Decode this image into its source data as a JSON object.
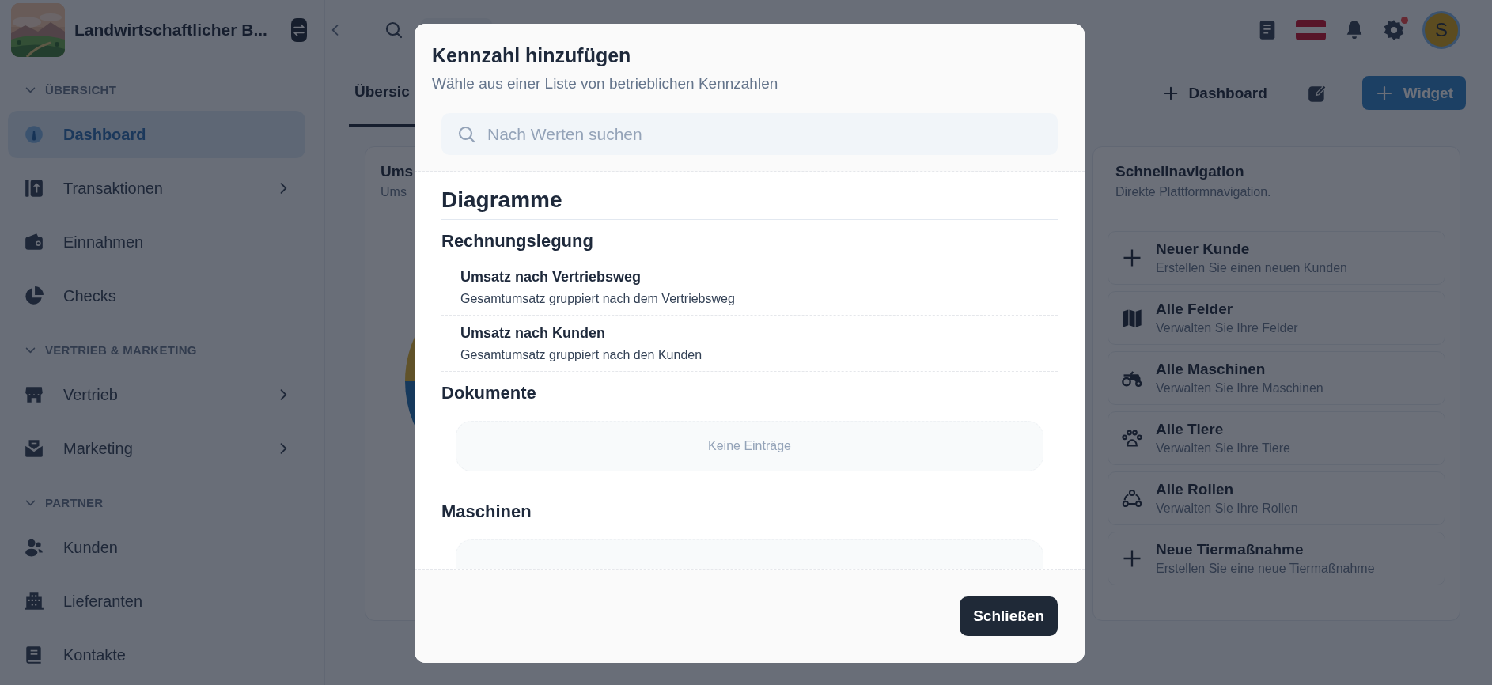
{
  "sidebar": {
    "company": "Landwirtschaftlicher B...",
    "sections": [
      {
        "title": "ÜBERSICHT",
        "expanded": true,
        "items": [
          {
            "label": "Dashboard",
            "selected": true,
            "has_submenu": false
          },
          {
            "label": "Transaktionen",
            "selected": false,
            "has_submenu": true
          },
          {
            "label": "Einnahmen",
            "selected": false,
            "has_submenu": false
          },
          {
            "label": "Checks",
            "selected": false,
            "has_submenu": false
          }
        ]
      },
      {
        "title": "VERTRIEB & MARKETING",
        "expanded": true,
        "items": [
          {
            "label": "Vertrieb",
            "selected": false,
            "has_submenu": true
          },
          {
            "label": "Marketing",
            "selected": false,
            "has_submenu": true
          }
        ]
      },
      {
        "title": "PARTNER",
        "expanded": true,
        "items": [
          {
            "label": "Kunden",
            "selected": false,
            "has_submenu": false
          },
          {
            "label": "Lieferanten",
            "selected": false,
            "has_submenu": false
          },
          {
            "label": "Kontakte",
            "selected": false,
            "has_submenu": false
          }
        ]
      }
    ]
  },
  "topbar": {
    "settings_badge": true,
    "avatar_initial": "S"
  },
  "main": {
    "tabs": [
      {
        "label": "Übersic",
        "selected": true
      }
    ],
    "dashboard_button": "Dashboard",
    "widget_button": "Widget",
    "chart_card": {
      "title": "Ums",
      "subtitle": "Ums"
    },
    "quick_nav": {
      "title": "Schnellnavigation",
      "subtitle": "Direkte Plattformnavigation.",
      "items": [
        {
          "title": "Neuer Kunde",
          "description": "Erstellen Sie einen neuen Kunden"
        },
        {
          "title": "Alle Felder",
          "description": "Verwalten Sie Ihre Felder"
        },
        {
          "title": "Alle Maschinen",
          "description": "Verwalten Sie Ihre Maschinen"
        },
        {
          "title": "Alle Tiere",
          "description": "Verwalten Sie Ihre Tiere"
        },
        {
          "title": "Alle Rollen",
          "description": "Verwalten Sie Ihre Rollen"
        },
        {
          "title": "Neue Tiermaßnahme",
          "description": "Erstellen Sie eine neue Tiermaßnahme"
        }
      ]
    }
  },
  "dialog": {
    "title": "Kennzahl hinzufügen",
    "subtitle": "Wähle aus einer Liste von betrieblichen Kennzahlen",
    "search": {
      "placeholder": "Nach Werten suchen"
    },
    "groups": [
      {
        "title": "Diagramme",
        "categories": [
          {
            "title": "Rechnungslegung",
            "entries": [
              {
                "title": "Umsatz nach Vertriebsweg",
                "description": "Gesamtumsatz gruppiert nach dem Vertriebsweg"
              },
              {
                "title": "Umsatz nach Kunden",
                "description": "Gesamtumsatz gruppiert nach den Kunden"
              }
            ]
          },
          {
            "title": "Dokumente",
            "empty_text": "Keine Einträge"
          },
          {
            "title": "Maschinen"
          }
        ]
      }
    ],
    "close_button": "Schließen"
  }
}
